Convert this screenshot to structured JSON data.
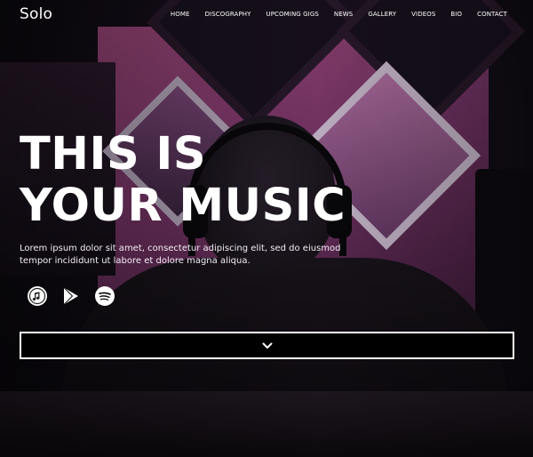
{
  "header": {
    "logo": "Solo",
    "nav": [
      "HOME",
      "DISCOGRAPHY",
      "UPCOMING GIGS",
      "NEWS",
      "GALLERY",
      "VIDEOS",
      "BIO",
      "CONTACT"
    ]
  },
  "hero": {
    "title_line1": "THIS IS",
    "title_line2": "YOUR MUSIC",
    "description": "Lorem ipsum dolor sit amet, consectetur adipiscing elit, sed do eiusmod tempor incididunt ut labore et dolore magna aliqua."
  },
  "stores": [
    {
      "icon": "apple-music-icon"
    },
    {
      "icon": "google-play-icon"
    },
    {
      "icon": "spotify-icon"
    }
  ],
  "scroll_button": {
    "icon": "chevron-down-icon"
  },
  "colors": {
    "text": "#ffffff",
    "button_bg": "#000000",
    "button_border": "#ffffff"
  }
}
